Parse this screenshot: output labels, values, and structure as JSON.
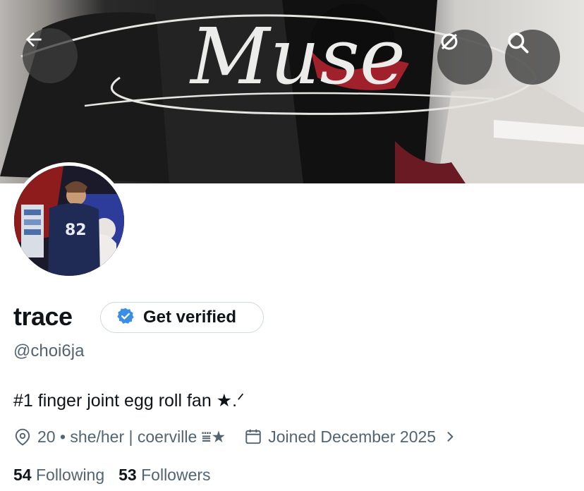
{
  "header": {
    "back_icon": "arrow-left-icon",
    "ext_icon": "link-off-icon",
    "search_icon": "search-icon",
    "banner_text": "Muse"
  },
  "profile": {
    "name": "trace",
    "verify_label": "Get verified",
    "handle": "@choi6ja",
    "bio": "#1 finger joint egg roll fan ★.ᐟ",
    "location": "20 • she/her | coerville ⩸★",
    "joined": "Joined December 2025",
    "avatar_jersey_number": "82"
  },
  "stats": {
    "following_count": "54",
    "following_label": "Following",
    "followers_count": "53",
    "followers_label": "Followers"
  },
  "colors": {
    "verify_badge": "#3a8ee6",
    "secondary_text": "#536471",
    "primary_text": "#0f1419"
  }
}
